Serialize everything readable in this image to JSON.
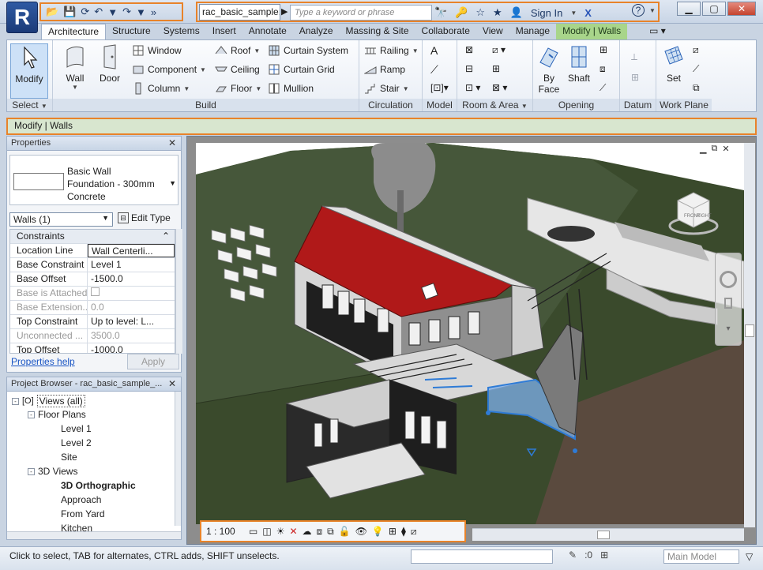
{
  "app": {
    "logo_letter": "R",
    "document_tab": "rac_basic_sample...",
    "search_placeholder": "Type a keyword or phrase",
    "sign_in": "Sign In",
    "help": "?"
  },
  "ribbon": {
    "tabs": [
      "Architecture",
      "Structure",
      "Systems",
      "Insert",
      "Annotate",
      "Analyze",
      "Massing & Site",
      "Collaborate",
      "View",
      "Manage",
      "Modify | Walls"
    ],
    "active_tab": "Architecture",
    "groups": {
      "select": {
        "label": "Select",
        "modify": "Modify"
      },
      "build": {
        "label": "Build",
        "wall": "Wall",
        "door": "Door",
        "window": "Window",
        "component": "Component",
        "column": "Column",
        "roof": "Roof",
        "ceiling": "Ceiling",
        "floor": "Floor",
        "curtain_system": "Curtain System",
        "curtain_grid": "Curtain Grid",
        "mullion": "Mullion"
      },
      "circulation": {
        "label": "Circulation",
        "railing": "Railing",
        "ramp": "Ramp",
        "stair": "Stair"
      },
      "model": {
        "label": "Model"
      },
      "room_area": {
        "label": "Room & Area"
      },
      "opening": {
        "label": "Opening",
        "by_face_1": "By",
        "by_face_2": "Face",
        "shaft": "Shaft"
      },
      "datum": {
        "label": "Datum"
      },
      "work_plane": {
        "label": "Work Plane",
        "set": "Set"
      }
    }
  },
  "options_bar": {
    "text": "Modify | Walls"
  },
  "properties": {
    "title": "Properties",
    "type_lines": [
      "Basic Wall",
      "Foundation - 300mm",
      "Concrete"
    ],
    "instance_selector": "Walls (1)",
    "edit_type": "Edit Type",
    "group": "Constraints",
    "rows": [
      {
        "key": "Location Line",
        "value": "Wall Centerli..."
      },
      {
        "key": "Base Constraint",
        "value": "Level 1"
      },
      {
        "key": "Base Offset",
        "value": "-1500.0"
      },
      {
        "key": "Base is Attached",
        "value": ""
      },
      {
        "key": "Base Extension...",
        "value": "0.0"
      },
      {
        "key": "Top Constraint",
        "value": "Up to level: L..."
      },
      {
        "key": "Unconnected ...",
        "value": "3500.0"
      },
      {
        "key": "Top Offset",
        "value": "-1000.0"
      }
    ],
    "help_link": "Properties help",
    "apply": "Apply"
  },
  "project_browser": {
    "title": "Project Browser - rac_basic_sample_...",
    "items": [
      {
        "label": "Views (all)",
        "level": 0,
        "box": "-"
      },
      {
        "label": "Floor Plans",
        "level": 1,
        "box": "-"
      },
      {
        "label": "Level 1",
        "level": 2
      },
      {
        "label": "Level 2",
        "level": 2
      },
      {
        "label": "Site",
        "level": 2
      },
      {
        "label": "3D Views",
        "level": 1,
        "box": "-"
      },
      {
        "label": "3D Orthographic",
        "level": 2,
        "bold": true
      },
      {
        "label": "Approach",
        "level": 2
      },
      {
        "label": "From Yard",
        "level": 2
      },
      {
        "label": "Kitchen",
        "level": 2
      }
    ]
  },
  "view_control": {
    "scale": "1 : 100"
  },
  "status": {
    "text": "Click to select, TAB for alternates, CTRL adds, SHIFT unselects.",
    "worksets": ":0",
    "model": "Main Model"
  },
  "viewcube": {
    "front": "FRONT",
    "right": "RIGHT"
  },
  "colors": {
    "accent_outline": "#e8832a",
    "roof": "#b01919",
    "terrain": "#3a4a2c",
    "selection": "#2e7bd6"
  }
}
